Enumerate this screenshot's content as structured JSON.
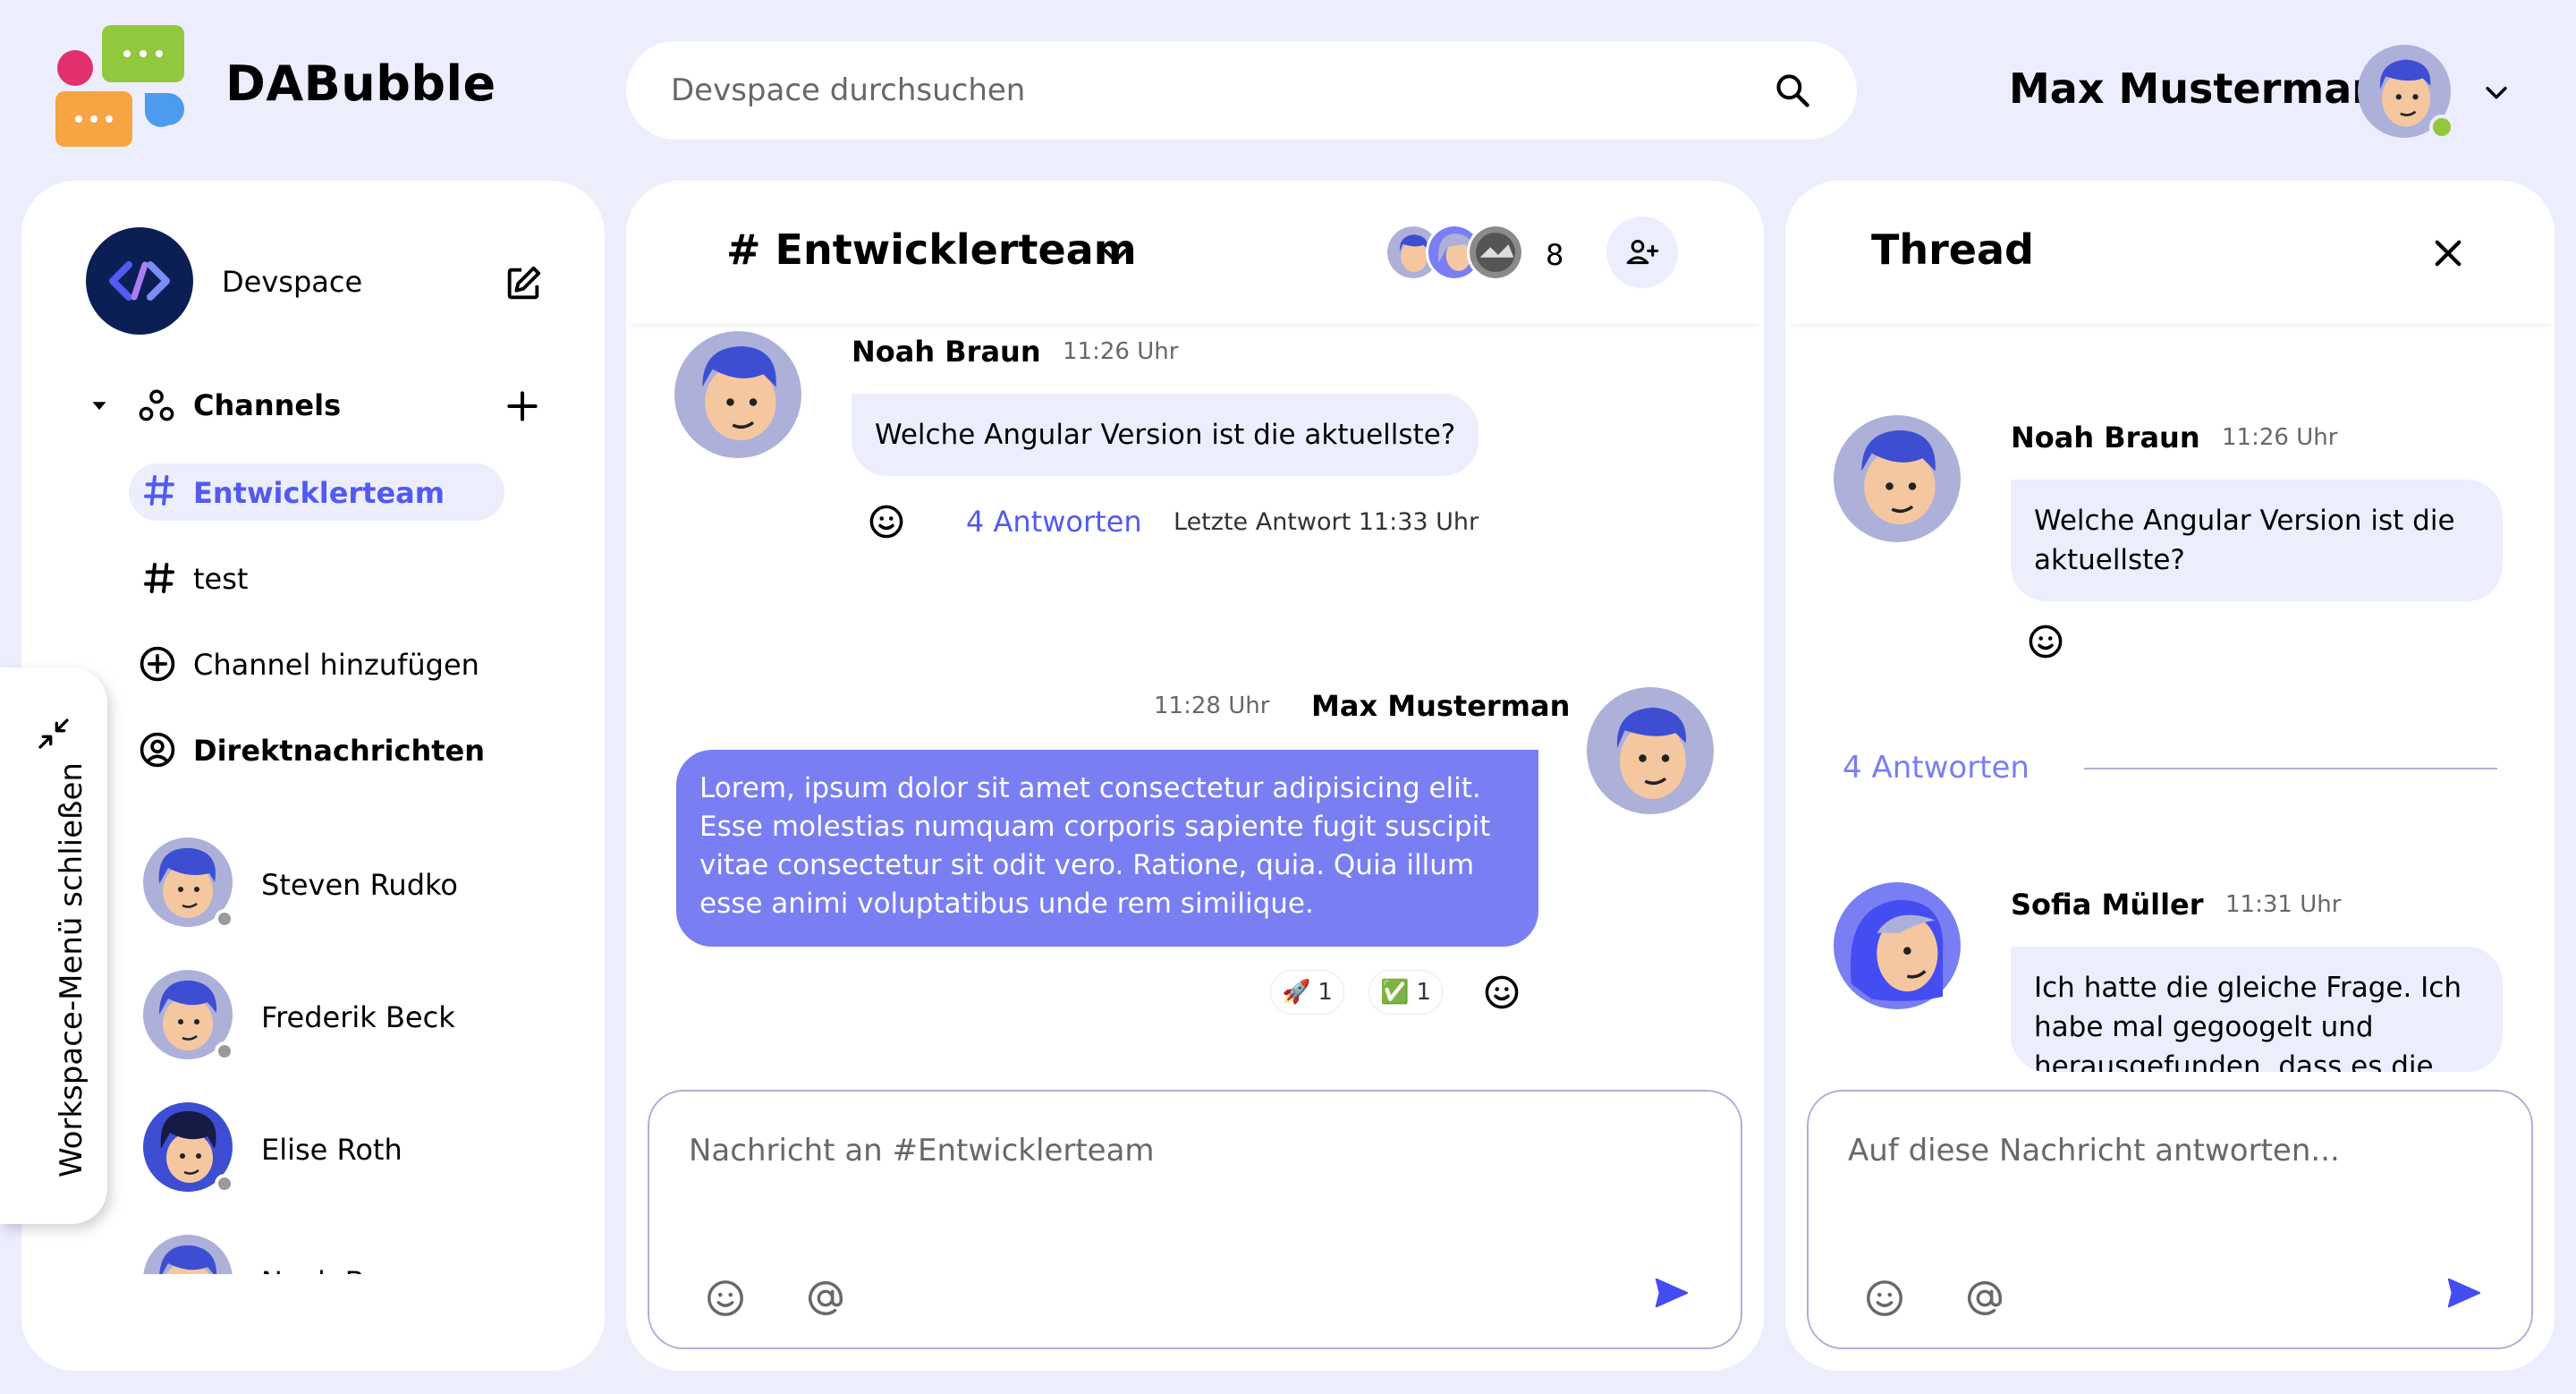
{
  "header": {
    "brand": "DABubble",
    "search_placeholder": "Devspace durchsuchen",
    "user_name": "Max Musterman"
  },
  "sidebar": {
    "workspace_name": "Devspace",
    "channels_label": "Channels",
    "channels": [
      {
        "label": "Entwicklerteam",
        "active": true
      },
      {
        "label": "test",
        "active": false
      }
    ],
    "add_channel_label": "Channel hinzufügen",
    "direct_messages_label": "Direktnachrichten",
    "contacts": [
      {
        "name": "Steven Rudko",
        "status": "offline"
      },
      {
        "name": "Frederik Beck",
        "status": "offline"
      },
      {
        "name": "Elise Roth",
        "status": "offline"
      },
      {
        "name": "Noah Braun",
        "status": "offline"
      }
    ],
    "toggle_label": "Workspace-Menü schließen"
  },
  "channel": {
    "title": "# Entwicklerteam",
    "member_count": "8",
    "messages": [
      {
        "author": "Noah Braun",
        "time": "11:26 Uhr",
        "text": "Welche Angular Version ist die aktuellste?",
        "answers": "4 Antworten",
        "last_answer": "Letzte Antwort 11:33 Uhr"
      },
      {
        "author": "Max Musterman",
        "time": "11:28 Uhr",
        "text": "Lorem, ipsum dolor sit amet consectetur adipisicing elit. Esse molestias numquam corporis sapiente fugit suscipit vitae consectetur sit odit vero. Ratione, quia. Quia illum esse animi voluptatibus unde rem similique.",
        "reactions": [
          {
            "emoji": "🚀",
            "count": "1"
          },
          {
            "emoji": "✅",
            "count": "1"
          }
        ]
      }
    ],
    "input_placeholder": "Nachricht an #Entwicklerteam"
  },
  "thread": {
    "title": "Thread",
    "root": {
      "author": "Noah Braun",
      "time": "11:26 Uhr",
      "text": "Welche Angular Version ist die aktuellste?"
    },
    "answers_divider": "4 Antworten",
    "replies": [
      {
        "author": "Sofia Müller",
        "time": "11:31 Uhr",
        "text": "Ich hatte die gleiche Frage. Ich habe mal gegoogelt und herausgefunden, dass es die"
      }
    ],
    "input_placeholder": "Auf diese Nachricht antworten..."
  },
  "colors": {
    "background": "#ECEEFE",
    "accent": "#535AF1",
    "bubble_own": "#797EF3",
    "online": "#92C83E"
  }
}
